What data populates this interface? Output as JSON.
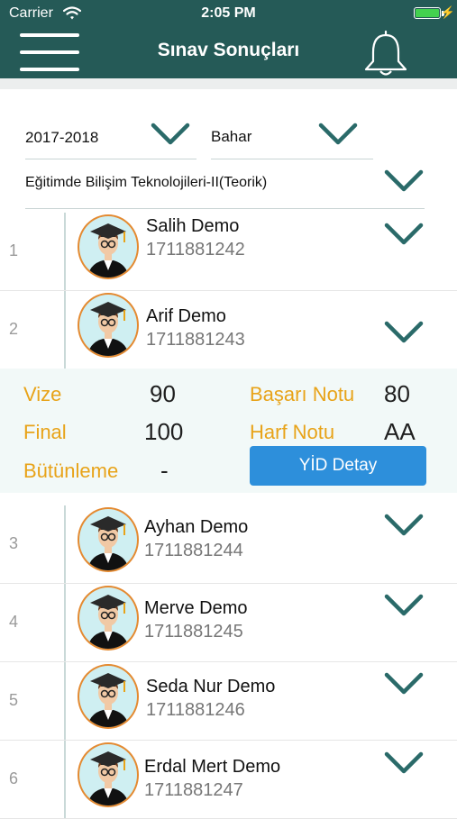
{
  "status_bar": {
    "carrier": "Carrier",
    "time": "2:05 PM"
  },
  "nav": {
    "title": "Sınav Sonuçları"
  },
  "filters": {
    "year": "2017-2018",
    "term": "Bahar",
    "course": "Eğitimde Bilişim Teknolojileri-II(Teorik)"
  },
  "students": [
    {
      "num": "1",
      "name": "Salih Demo",
      "id": "1711881242"
    },
    {
      "num": "2",
      "name": "Arif Demo",
      "id": "1711881243"
    },
    {
      "num": "3",
      "name": "Ayhan Demo",
      "id": "1711881244"
    },
    {
      "num": "4",
      "name": "Merve Demo",
      "id": "1711881245"
    },
    {
      "num": "5",
      "name": "Seda Nur Demo",
      "id": "1711881246"
    },
    {
      "num": "6",
      "name": "Erdal Mert Demo",
      "id": "1711881247"
    }
  ],
  "detail": {
    "vize_label": "Vize",
    "vize_value": "90",
    "final_label": "Final",
    "final_value": "100",
    "butunleme_label": "Bütünleme",
    "butunleme_value": "-",
    "basari_label": "Başarı Notu",
    "basari_value": "80",
    "harf_label": "Harf Notu",
    "harf_value": "AA",
    "button_label": "YİD Detay"
  },
  "colors": {
    "header": "#255a57",
    "accent": "#e8a319",
    "chevron": "#2a6a69",
    "button": "#2d8fdb"
  }
}
